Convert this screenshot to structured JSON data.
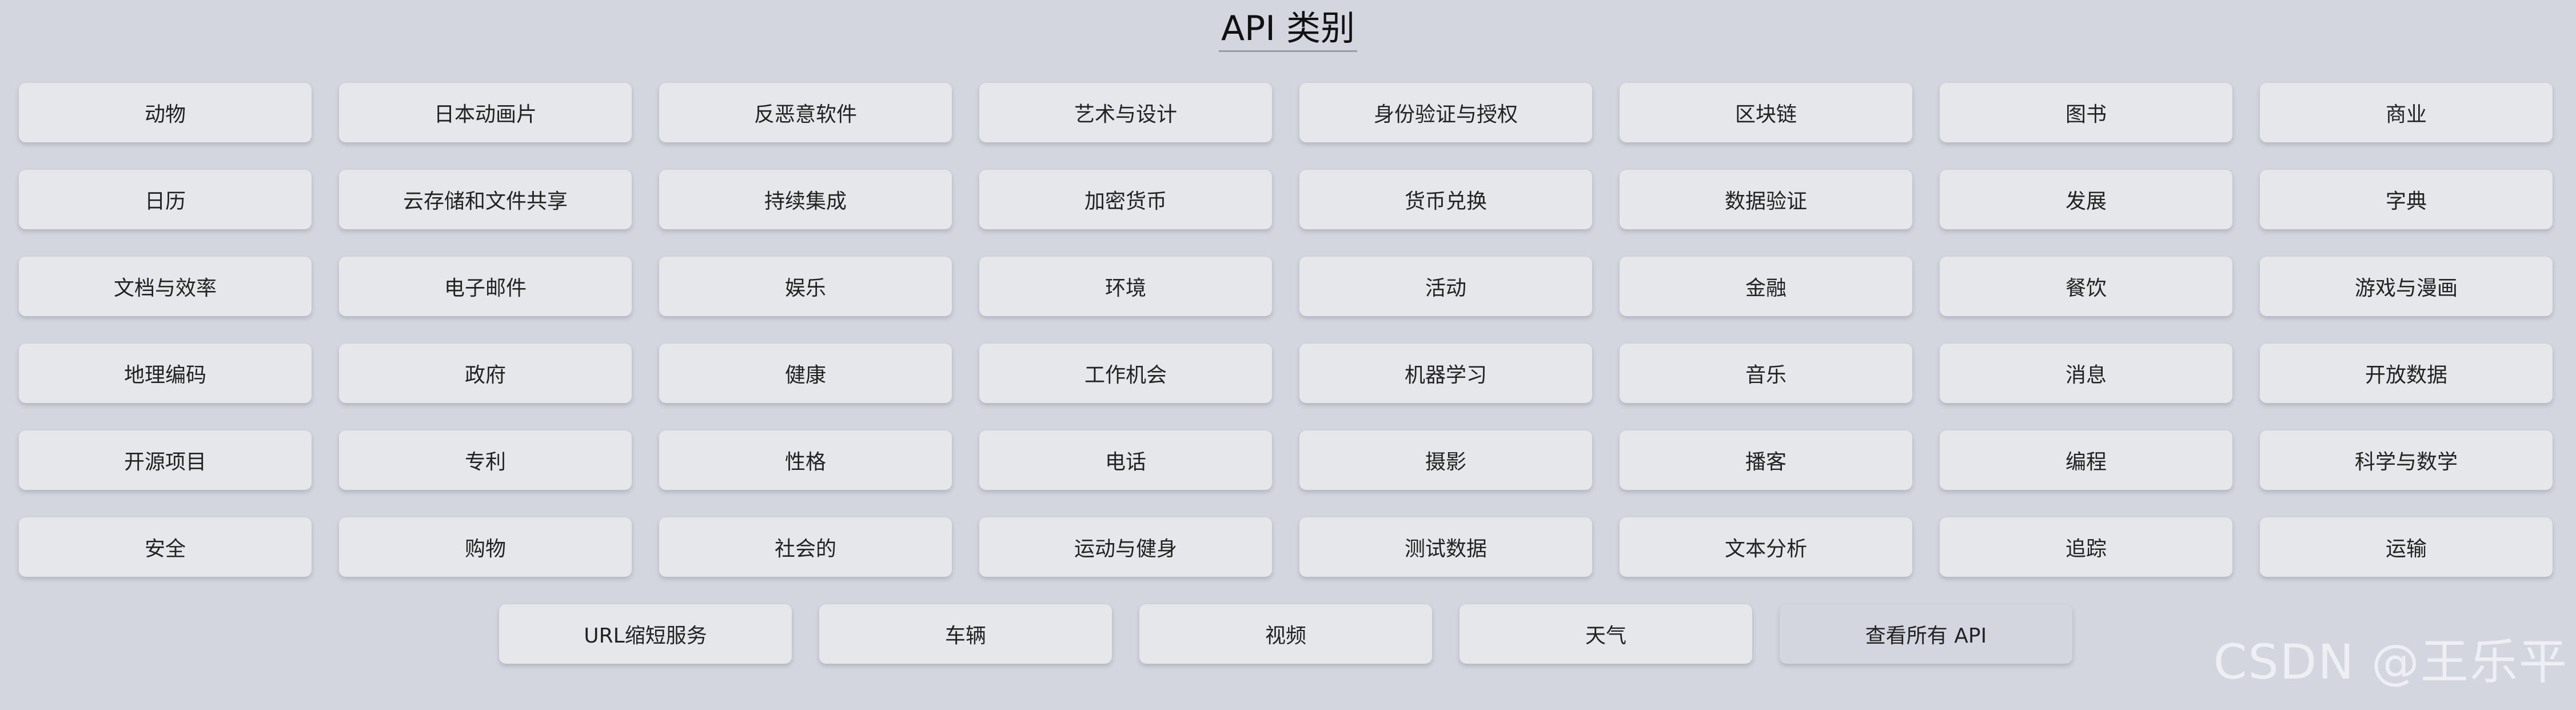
{
  "page": {
    "title": "API 类别"
  },
  "categories": [
    "动物",
    "日本动画片",
    "反恶意软件",
    "艺术与设计",
    "身份验证与授权",
    "区块链",
    "图书",
    "商业",
    "日历",
    "云存储和文件共享",
    "持续集成",
    "加密货币",
    "货币兑换",
    "数据验证",
    "发展",
    "字典",
    "文档与效率",
    "电子邮件",
    "娱乐",
    "环境",
    "活动",
    "金融",
    "餐饮",
    "游戏与漫画",
    "地理编码",
    "政府",
    "健康",
    "工作机会",
    "机器学习",
    "音乐",
    "消息",
    "开放数据",
    "开源项目",
    "专利",
    "性格",
    "电话",
    "摄影",
    "播客",
    "编程",
    "科学与数学",
    "安全",
    "购物",
    "社会的",
    "运动与健身",
    "测试数据",
    "文本分析",
    "追踪",
    "运输"
  ],
  "last_row": [
    "URL缩短服务",
    "车辆",
    "视频",
    "天气"
  ],
  "view_all_label": "查看所有 API",
  "watermark": "CSDN @王乐平",
  "colors": {
    "background": "#d3d6de",
    "button": "#e6e7eb",
    "text": "#222222"
  }
}
